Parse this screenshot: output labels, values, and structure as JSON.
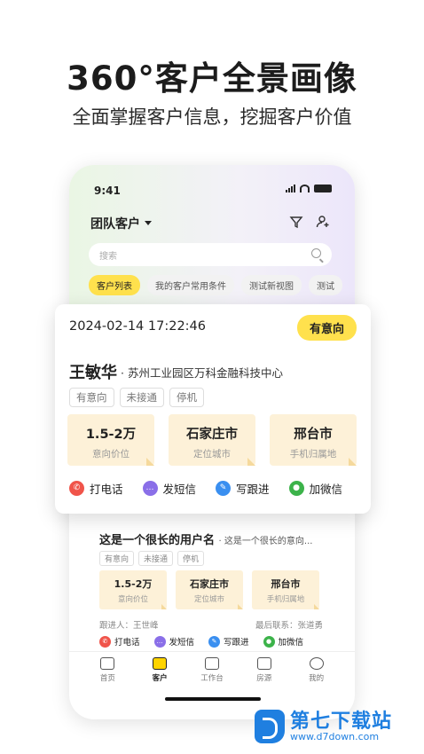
{
  "promo": {
    "headline": "360°客户全景画像",
    "subline": "全面掌握客户信息，挖掘客户价值"
  },
  "status_bar": {
    "time": "9:41"
  },
  "header": {
    "title": "团队客户"
  },
  "search": {
    "placeholder": "搜索"
  },
  "view_tabs": [
    "客户列表",
    "我的客户常用条件",
    "测试新视图",
    "测试"
  ],
  "featured_card": {
    "datetime": "2024-02-14 17:22:46",
    "intent_badge": "有意向",
    "name": "王敏华",
    "company": "· 苏州工业园区万科金融科技中心",
    "tags": [
      "有意向",
      "未接通",
      "停机"
    ],
    "stats": [
      {
        "value": "1.5-2万",
        "label": "意向价位"
      },
      {
        "value": "石家庄市",
        "label": "定位城市"
      },
      {
        "value": "邢台市",
        "label": "手机归属地"
      }
    ],
    "actions": [
      "打电话",
      "发短信",
      "写跟进",
      "加微信"
    ]
  },
  "list_card": {
    "name": "这是一个很长的用户名",
    "company": "· 这是一个很长的意向...",
    "tags": [
      "有意向",
      "未接通",
      "停机"
    ],
    "stats": [
      {
        "value": "1.5-2万",
        "label": "意向价位"
      },
      {
        "value": "石家庄市",
        "label": "定位城市"
      },
      {
        "value": "邢台市",
        "label": "手机归属地"
      }
    ],
    "follower": "跟进人：王世峰",
    "last_contact": "最后联系：张道勇",
    "actions": [
      "打电话",
      "发短信",
      "写跟进",
      "加微信"
    ]
  },
  "tabbar": [
    "首页",
    "客户",
    "工作台",
    "房源",
    "我的"
  ],
  "watermark": {
    "name": "第七下载站",
    "url": "www.d7down.com"
  },
  "colors": {
    "accent_yellow": "#ffe14d",
    "stat_bg": "#fdf1d8",
    "brand_blue": "#1f7fe0"
  }
}
